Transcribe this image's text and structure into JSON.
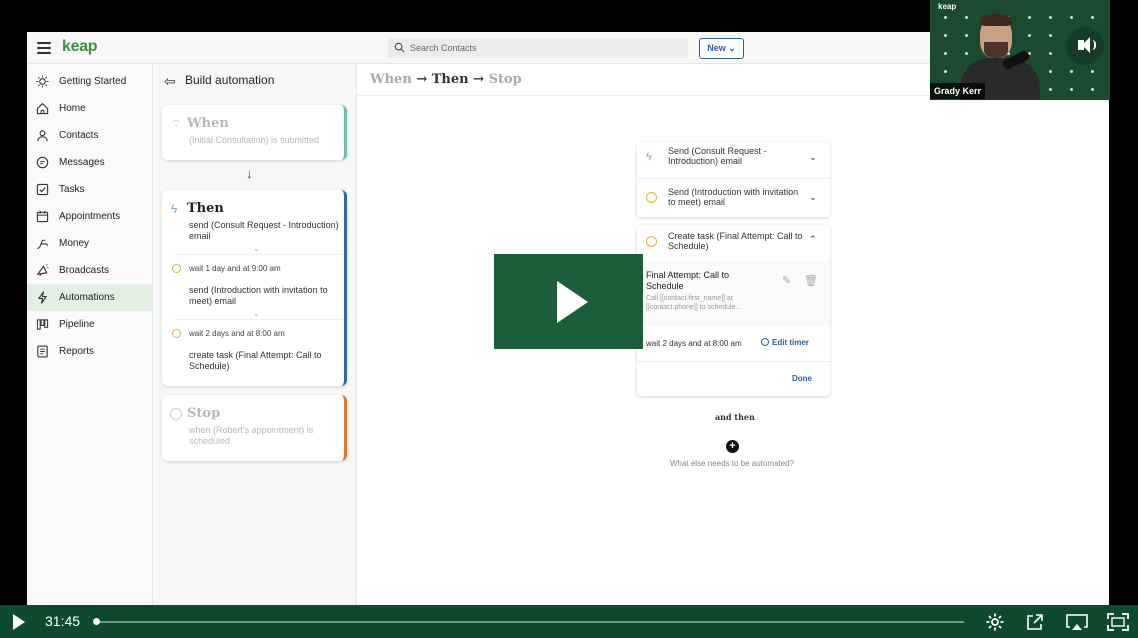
{
  "app": {
    "logo": "keap",
    "search_placeholder": "Search Contacts",
    "new_button": "New ⌄"
  },
  "sidebar": {
    "items": [
      {
        "label": "Getting Started",
        "icon": "lightbulb-icon"
      },
      {
        "label": "Home",
        "icon": "home-icon"
      },
      {
        "label": "Contacts",
        "icon": "person-icon"
      },
      {
        "label": "Messages",
        "icon": "chat-icon"
      },
      {
        "label": "Tasks",
        "icon": "checkbox-icon"
      },
      {
        "label": "Appointments",
        "icon": "calendar-icon"
      },
      {
        "label": "Money",
        "icon": "money-icon"
      },
      {
        "label": "Broadcasts",
        "icon": "broadcast-icon"
      },
      {
        "label": "Automations",
        "icon": "bolt-icon",
        "active": true
      },
      {
        "label": "Pipeline",
        "icon": "pipeline-icon"
      },
      {
        "label": "Reports",
        "icon": "reports-icon"
      }
    ]
  },
  "builder": {
    "title": "Build automation",
    "when": {
      "title": "When",
      "sub": "(Initial Consultation) is submitted"
    },
    "then": {
      "title": "Then",
      "step1": "send (Consult Request - Introduction) email",
      "wait1": "wait 1 day and at 9:00 am",
      "step2": "send (Introduction with invitation to meet) email",
      "wait2": "wait 2 days and at 8:00 am",
      "step3": "create task (Final Attempt: Call to Schedule)"
    },
    "stop": {
      "title": "Stop",
      "sub": "when (Robert's appointment) is scheduled"
    }
  },
  "main": {
    "crumb_when": "When",
    "crumb_then": "Then",
    "crumb_stop": "Stop",
    "arrow": "→",
    "row1": "Send (Consult Request - Introduction) email",
    "row2": "Send (Introduction with invitation to meet) email",
    "row3": "Create task (Final Attempt: Call to Schedule)",
    "task_title": "Final Attempt: Call to Schedule",
    "task_body": "Call [[contact.first_name]] at [[contact.phone]] to schedule...",
    "task_wait": "wait 2 days and at 8:00 am",
    "edit_timer": "Edit timer",
    "done": "Done",
    "and_then": "and then",
    "what_else": "What else needs to be automated?"
  },
  "webcam": {
    "logo": "keap",
    "name": "Grady Kerr"
  },
  "player": {
    "time": "31:45",
    "progress": 0.0
  },
  "colors": {
    "brand_green": "#3a8f3a",
    "player_green": "#0f4a2f",
    "overlay_green": "#1d5e3a",
    "link_blue": "#2a5fa8"
  }
}
